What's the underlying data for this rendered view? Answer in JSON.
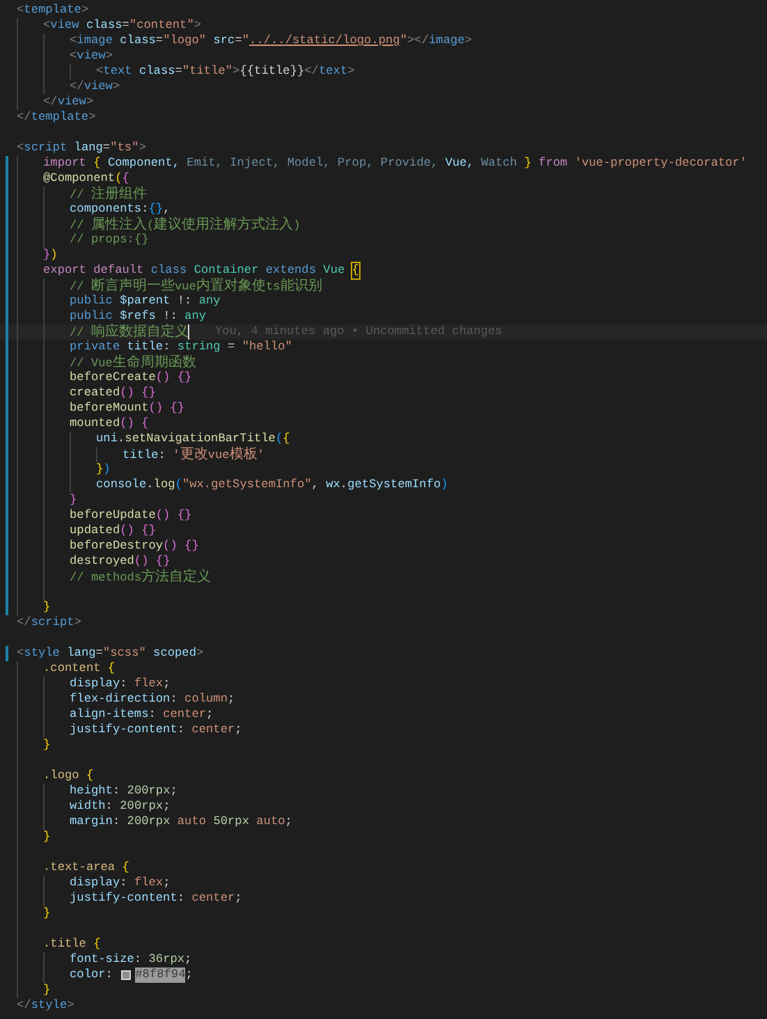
{
  "editor": {
    "lines": [
      {
        "changed": false,
        "tokens": [
          {
            "text": "<",
            "kind": "punct"
          },
          {
            "text": "template",
            "kind": "tag"
          },
          {
            "text": ">",
            "kind": "punct"
          }
        ],
        "children": [
          {
            "changed": false,
            "tokens": [
              {
                "text": "<",
                "kind": "punct"
              },
              {
                "text": "view",
                "kind": "tag"
              },
              {
                "text": " class",
                "kind": "attr"
              },
              {
                "text": "=",
                "kind": "plain"
              },
              {
                "text": "\"content\"",
                "kind": "str"
              },
              {
                "text": ">",
                "kind": "punct"
              }
            ],
            "children": [
              {
                "changed": false,
                "tokens": [
                  {
                    "text": "<",
                    "kind": "punct"
                  },
                  {
                    "text": "image",
                    "kind": "tag"
                  },
                  {
                    "text": " class",
                    "kind": "attr"
                  },
                  {
                    "text": "=",
                    "kind": "plain"
                  },
                  {
                    "text": "\"logo\"",
                    "kind": "str"
                  },
                  {
                    "text": " src",
                    "kind": "attr"
                  },
                  {
                    "text": "=",
                    "kind": "plain"
                  },
                  {
                    "text": "\"",
                    "kind": "str"
                  },
                  {
                    "text": "../../static/logo.png",
                    "kind": "link"
                  },
                  {
                    "text": "\"",
                    "kind": "str"
                  },
                  {
                    "text": "></",
                    "kind": "punct"
                  },
                  {
                    "text": "image",
                    "kind": "tag"
                  },
                  {
                    "text": ">",
                    "kind": "punct"
                  }
                ]
              },
              {
                "changed": false,
                "tokens": [
                  {
                    "text": "<",
                    "kind": "punct"
                  },
                  {
                    "text": "view",
                    "kind": "tag"
                  },
                  {
                    "text": ">",
                    "kind": "punct"
                  }
                ],
                "children": [
                  {
                    "changed": false,
                    "tokens": [
                      {
                        "text": "<",
                        "kind": "punct"
                      },
                      {
                        "text": "text",
                        "kind": "tag"
                      },
                      {
                        "text": " class",
                        "kind": "attr"
                      },
                      {
                        "text": "=",
                        "kind": "plain"
                      },
                      {
                        "text": "\"title\"",
                        "kind": "str"
                      },
                      {
                        "text": ">",
                        "kind": "punct"
                      },
                      {
                        "text": "{{title}}",
                        "kind": "plain"
                      },
                      {
                        "text": "</",
                        "kind": "punct"
                      },
                      {
                        "text": "text",
                        "kind": "tag"
                      },
                      {
                        "text": ">",
                        "kind": "punct"
                      }
                    ]
                  }
                ]
              },
              {
                "changed": false,
                "tokens": [
                  {
                    "text": "</",
                    "kind": "punct"
                  },
                  {
                    "text": "view",
                    "kind": "tag"
                  },
                  {
                    "text": ">",
                    "kind": "punct"
                  }
                ]
              }
            ]
          },
          {
            "changed": false,
            "tokens": [
              {
                "text": "</",
                "kind": "punct"
              },
              {
                "text": "view",
                "kind": "tag"
              },
              {
                "text": ">",
                "kind": "punct"
              }
            ]
          }
        ]
      },
      {
        "changed": false,
        "tokens": [
          {
            "text": "</",
            "kind": "punct"
          },
          {
            "text": "template",
            "kind": "tag"
          },
          {
            "text": ">",
            "kind": "punct"
          }
        ]
      },
      {
        "changed": false
      },
      {
        "changed": false,
        "tokens": [
          {
            "text": "<",
            "kind": "punct"
          },
          {
            "text": "script",
            "kind": "tag"
          },
          {
            "text": " lang",
            "kind": "attr"
          },
          {
            "text": "=",
            "kind": "plain"
          },
          {
            "text": "\"ts\"",
            "kind": "str"
          },
          {
            "text": ">",
            "kind": "punct"
          }
        ],
        "children": [
          {
            "changed": true,
            "tokens": [
              {
                "text": "import ",
                "kind": "kw"
              },
              {
                "text": "{",
                "kind": "br1"
              },
              {
                "text": " Component, ",
                "kind": "var"
              },
              {
                "text": "Emit, Inject, Model, Prop, Provide,",
                "kind": "dimvar"
              },
              {
                "text": " Vue, ",
                "kind": "var"
              },
              {
                "text": "Watch ",
                "kind": "dimvar"
              },
              {
                "text": "}",
                "kind": "br1"
              },
              {
                "text": " from ",
                "kind": "kw"
              },
              {
                "text": "'vue-property-decorator'",
                "kind": "str"
              }
            ]
          },
          {
            "changed": true,
            "tokens": [
              {
                "text": "@Component",
                "kind": "fn"
              },
              {
                "text": "(",
                "kind": "br1"
              },
              {
                "text": "{",
                "kind": "br2"
              }
            ],
            "children": [
              {
                "changed": true,
                "tokens": [
                  {
                    "text": "// 注册组件",
                    "kind": "comment"
                  }
                ]
              },
              {
                "changed": true,
                "tokens": [
                  {
                    "text": "components",
                    "kind": "var"
                  },
                  {
                    "text": ":",
                    "kind": "plain"
                  },
                  {
                    "text": "{}",
                    "kind": "br3"
                  },
                  {
                    "text": ",",
                    "kind": "plain"
                  }
                ]
              },
              {
                "changed": true,
                "tokens": [
                  {
                    "text": "// 属性注入(建议使用注解方式注入)",
                    "kind": "comment"
                  }
                ]
              },
              {
                "changed": true,
                "tokens": [
                  {
                    "text": "// props:{}",
                    "kind": "comment"
                  }
                ]
              }
            ]
          },
          {
            "changed": true,
            "tokens": [
              {
                "text": "}",
                "kind": "br2"
              },
              {
                "text": ")",
                "kind": "br1"
              }
            ]
          },
          {
            "changed": true,
            "tokens": [
              {
                "text": "export default ",
                "kind": "kw"
              },
              {
                "text": "class ",
                "kind": "kw2"
              },
              {
                "text": "Container",
                "kind": "type"
              },
              {
                "text": " extends ",
                "kind": "kw2"
              },
              {
                "text": "Vue ",
                "kind": "type"
              },
              {
                "text": "{",
                "kind": "bracket-match"
              }
            ],
            "children": [
              {
                "changed": true,
                "tokens": [
                  {
                    "text": "// 断言声明一些vue内置对象使ts能识别",
                    "kind": "comment"
                  }
                ]
              },
              {
                "changed": true,
                "tokens": [
                  {
                    "text": "public ",
                    "kind": "kw2"
                  },
                  {
                    "text": "$parent",
                    "kind": "var"
                  },
                  {
                    "text": " !: ",
                    "kind": "plain"
                  },
                  {
                    "text": "any",
                    "kind": "type"
                  }
                ]
              },
              {
                "changed": true,
                "tokens": [
                  {
                    "text": "public ",
                    "kind": "kw2"
                  },
                  {
                    "text": "$refs",
                    "kind": "var"
                  },
                  {
                    "text": " !: ",
                    "kind": "plain"
                  },
                  {
                    "text": "any",
                    "kind": "type"
                  }
                ]
              },
              {
                "changed": true,
                "current": true,
                "blame": "You, 4 minutes ago • Uncommitted changes",
                "tokens": [
                  {
                    "text": "// 响应数据自定义",
                    "kind": "comment"
                  }
                ]
              },
              {
                "changed": true,
                "tokens": [
                  {
                    "text": "private ",
                    "kind": "kw2"
                  },
                  {
                    "text": "title",
                    "kind": "var"
                  },
                  {
                    "text": ": ",
                    "kind": "plain"
                  },
                  {
                    "text": "string",
                    "kind": "type"
                  },
                  {
                    "text": " = ",
                    "kind": "plain"
                  },
                  {
                    "text": "\"hello\"",
                    "kind": "str"
                  }
                ]
              },
              {
                "changed": true,
                "tokens": [
                  {
                    "text": "// Vue生命周期函数",
                    "kind": "comment"
                  }
                ]
              },
              {
                "changed": true,
                "tokens": [
                  {
                    "text": "beforeCreate",
                    "kind": "fn"
                  },
                  {
                    "text": "() ",
                    "kind": "br2"
                  },
                  {
                    "text": "{}",
                    "kind": "br2"
                  }
                ]
              },
              {
                "changed": true,
                "tokens": [
                  {
                    "text": "created",
                    "kind": "fn"
                  },
                  {
                    "text": "() ",
                    "kind": "br2"
                  },
                  {
                    "text": "{}",
                    "kind": "br2"
                  }
                ]
              },
              {
                "changed": true,
                "tokens": [
                  {
                    "text": "beforeMount",
                    "kind": "fn"
                  },
                  {
                    "text": "() ",
                    "kind": "br2"
                  },
                  {
                    "text": "{}",
                    "kind": "br2"
                  }
                ]
              },
              {
                "changed": true,
                "tokens": [
                  {
                    "text": "mounted",
                    "kind": "fn"
                  },
                  {
                    "text": "() ",
                    "kind": "br2"
                  },
                  {
                    "text": "{",
                    "kind": "br2"
                  }
                ],
                "children": [
                  {
                    "changed": true,
                    "tokens": [
                      {
                        "text": "uni",
                        "kind": "var"
                      },
                      {
                        "text": ".",
                        "kind": "plain"
                      },
                      {
                        "text": "setNavigationBarTitle",
                        "kind": "fn"
                      },
                      {
                        "text": "(",
                        "kind": "br3"
                      },
                      {
                        "text": "{",
                        "kind": "br1"
                      }
                    ],
                    "children": [
                      {
                        "changed": true,
                        "tokens": [
                          {
                            "text": "title",
                            "kind": "var"
                          },
                          {
                            "text": ": ",
                            "kind": "plain"
                          },
                          {
                            "text": "'更改vue模板'",
                            "kind": "str"
                          }
                        ]
                      }
                    ]
                  },
                  {
                    "changed": true,
                    "tokens": [
                      {
                        "text": "}",
                        "kind": "br1"
                      },
                      {
                        "text": ")",
                        "kind": "br3"
                      }
                    ]
                  },
                  {
                    "changed": true,
                    "tokens": [
                      {
                        "text": "console",
                        "kind": "var"
                      },
                      {
                        "text": ".",
                        "kind": "plain"
                      },
                      {
                        "text": "log",
                        "kind": "fn"
                      },
                      {
                        "text": "(",
                        "kind": "br3"
                      },
                      {
                        "text": "\"wx.getSystemInfo\"",
                        "kind": "str"
                      },
                      {
                        "text": ", ",
                        "kind": "plain"
                      },
                      {
                        "text": "wx",
                        "kind": "var"
                      },
                      {
                        "text": ".",
                        "kind": "plain"
                      },
                      {
                        "text": "getSystemInfo",
                        "kind": "var"
                      },
                      {
                        "text": ")",
                        "kind": "br3"
                      }
                    ]
                  }
                ]
              },
              {
                "changed": true,
                "tokens": [
                  {
                    "text": "}",
                    "kind": "br2"
                  }
                ]
              },
              {
                "changed": true,
                "tokens": [
                  {
                    "text": "beforeUpdate",
                    "kind": "fn"
                  },
                  {
                    "text": "() ",
                    "kind": "br2"
                  },
                  {
                    "text": "{}",
                    "kind": "br2"
                  }
                ]
              },
              {
                "changed": true,
                "tokens": [
                  {
                    "text": "updated",
                    "kind": "fn"
                  },
                  {
                    "text": "() ",
                    "kind": "br2"
                  },
                  {
                    "text": "{}",
                    "kind": "br2"
                  }
                ]
              },
              {
                "changed": true,
                "tokens": [
                  {
                    "text": "beforeDestroy",
                    "kind": "fn"
                  },
                  {
                    "text": "() ",
                    "kind": "br2"
                  },
                  {
                    "text": "{}",
                    "kind": "br2"
                  }
                ]
              },
              {
                "changed": true,
                "tokens": [
                  {
                    "text": "destroyed",
                    "kind": "fn"
                  },
                  {
                    "text": "() ",
                    "kind": "br2"
                  },
                  {
                    "text": "{}",
                    "kind": "br2"
                  }
                ]
              },
              {
                "changed": true,
                "tokens": [
                  {
                    "text": "// methods方法自定义",
                    "kind": "comment"
                  }
                ]
              },
              {
                "changed": true
              }
            ]
          },
          {
            "changed": true,
            "tokens": [
              {
                "text": "}",
                "kind": "br1"
              }
            ]
          }
        ]
      },
      {
        "changed": false,
        "tokens": [
          {
            "text": "</",
            "kind": "punct"
          },
          {
            "text": "script",
            "kind": "tag"
          },
          {
            "text": ">",
            "kind": "punct"
          }
        ]
      },
      {
        "changed": false
      },
      {
        "changed": true,
        "tokens": [
          {
            "text": "<",
            "kind": "punct"
          },
          {
            "text": "style",
            "kind": "tag"
          },
          {
            "text": " lang",
            "kind": "attr"
          },
          {
            "text": "=",
            "kind": "plain"
          },
          {
            "text": "\"scss\"",
            "kind": "str"
          },
          {
            "text": " scoped",
            "kind": "attr"
          },
          {
            "text": ">",
            "kind": "punct"
          }
        ],
        "children": [
          {
            "changed": false,
            "tokens": [
              {
                "text": ".content ",
                "kind": "sel"
              },
              {
                "text": "{",
                "kind": "br1"
              }
            ],
            "children": [
              {
                "changed": false,
                "tokens": [
                  {
                    "text": "display",
                    "kind": "var"
                  },
                  {
                    "text": ": ",
                    "kind": "plain"
                  },
                  {
                    "text": "flex",
                    "kind": "str"
                  },
                  {
                    "text": ";",
                    "kind": "plain"
                  }
                ]
              },
              {
                "changed": false,
                "tokens": [
                  {
                    "text": "flex-direction",
                    "kind": "var"
                  },
                  {
                    "text": ": ",
                    "kind": "plain"
                  },
                  {
                    "text": "column",
                    "kind": "str"
                  },
                  {
                    "text": ";",
                    "kind": "plain"
                  }
                ]
              },
              {
                "changed": false,
                "tokens": [
                  {
                    "text": "align-items",
                    "kind": "var"
                  },
                  {
                    "text": ": ",
                    "kind": "plain"
                  },
                  {
                    "text": "center",
                    "kind": "str"
                  },
                  {
                    "text": ";",
                    "kind": "plain"
                  }
                ]
              },
              {
                "changed": false,
                "tokens": [
                  {
                    "text": "justify-content",
                    "kind": "var"
                  },
                  {
                    "text": ": ",
                    "kind": "plain"
                  },
                  {
                    "text": "center",
                    "kind": "str"
                  },
                  {
                    "text": ";",
                    "kind": "plain"
                  }
                ]
              }
            ]
          },
          {
            "changed": false,
            "tokens": [
              {
                "text": "}",
                "kind": "br1"
              }
            ]
          },
          {
            "changed": false
          },
          {
            "changed": false,
            "tokens": [
              {
                "text": ".logo ",
                "kind": "sel"
              },
              {
                "text": "{",
                "kind": "br1"
              }
            ],
            "children": [
              {
                "changed": false,
                "tokens": [
                  {
                    "text": "height",
                    "kind": "var"
                  },
                  {
                    "text": ": ",
                    "kind": "plain"
                  },
                  {
                    "text": "200rpx",
                    "kind": "num"
                  },
                  {
                    "text": ";",
                    "kind": "plain"
                  }
                ]
              },
              {
                "changed": false,
                "tokens": [
                  {
                    "text": "width",
                    "kind": "var"
                  },
                  {
                    "text": ": ",
                    "kind": "plain"
                  },
                  {
                    "text": "200rpx",
                    "kind": "num"
                  },
                  {
                    "text": ";",
                    "kind": "plain"
                  }
                ]
              },
              {
                "changed": false,
                "tokens": [
                  {
                    "text": "margin",
                    "kind": "var"
                  },
                  {
                    "text": ": ",
                    "kind": "plain"
                  },
                  {
                    "text": "200rpx",
                    "kind": "num"
                  },
                  {
                    "text": " auto ",
                    "kind": "str"
                  },
                  {
                    "text": "50rpx",
                    "kind": "num"
                  },
                  {
                    "text": " auto",
                    "kind": "str"
                  },
                  {
                    "text": ";",
                    "kind": "plain"
                  }
                ]
              }
            ]
          },
          {
            "changed": false,
            "tokens": [
              {
                "text": "}",
                "kind": "br1"
              }
            ]
          },
          {
            "changed": false
          },
          {
            "changed": false,
            "tokens": [
              {
                "text": ".text-area ",
                "kind": "sel"
              },
              {
                "text": "{",
                "kind": "br1"
              }
            ],
            "children": [
              {
                "changed": false,
                "tokens": [
                  {
                    "text": "display",
                    "kind": "var"
                  },
                  {
                    "text": ": ",
                    "kind": "plain"
                  },
                  {
                    "text": "flex",
                    "kind": "str"
                  },
                  {
                    "text": ";",
                    "kind": "plain"
                  }
                ]
              },
              {
                "changed": false,
                "tokens": [
                  {
                    "text": "justify-content",
                    "kind": "var"
                  },
                  {
                    "text": ": ",
                    "kind": "plain"
                  },
                  {
                    "text": "center",
                    "kind": "str"
                  },
                  {
                    "text": ";",
                    "kind": "plain"
                  }
                ]
              }
            ]
          },
          {
            "changed": false,
            "tokens": [
              {
                "text": "}",
                "kind": "br1"
              }
            ]
          },
          {
            "changed": false
          },
          {
            "changed": false,
            "tokens": [
              {
                "text": ".title ",
                "kind": "sel"
              },
              {
                "text": "{",
                "kind": "br1"
              }
            ],
            "children": [
              {
                "changed": false,
                "tokens": [
                  {
                    "text": "font-size",
                    "kind": "var"
                  },
                  {
                    "text": ": ",
                    "kind": "plain"
                  },
                  {
                    "text": "36rpx",
                    "kind": "num"
                  },
                  {
                    "text": ";",
                    "kind": "plain"
                  }
                ]
              },
              {
                "changed": false,
                "tokens": [
                  {
                    "text": "color",
                    "kind": "var"
                  },
                  {
                    "text": ": ",
                    "kind": "plain"
                  },
                  {
                    "kind": "swatch"
                  },
                  {
                    "text": "#8f8f94",
                    "kind": "selected"
                  },
                  {
                    "text": ";",
                    "kind": "plain"
                  }
                ]
              }
            ]
          },
          {
            "changed": false,
            "tokens": [
              {
                "text": "}",
                "kind": "br1"
              }
            ]
          }
        ]
      },
      {
        "changed": false,
        "tokens": [
          {
            "text": "</",
            "kind": "punct"
          },
          {
            "text": "style",
            "kind": "tag"
          },
          {
            "text": ">",
            "kind": "punct"
          }
        ]
      }
    ]
  }
}
